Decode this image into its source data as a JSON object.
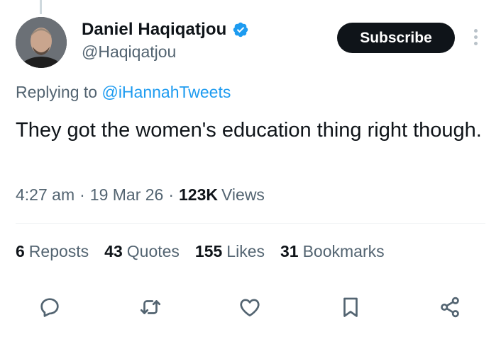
{
  "author": {
    "display_name": "Daniel Haqiqatjou",
    "handle": "@Haqiqatjou",
    "verified": true
  },
  "header": {
    "subscribe_label": "Subscribe"
  },
  "reply": {
    "prefix": "Replying to",
    "mention": "@iHannahTweets"
  },
  "tweet": {
    "text": "They got the women's education thing right though."
  },
  "meta": {
    "time": "4:27 am",
    "date": "19 Mar 26",
    "views_count": "123K",
    "views_label": "Views",
    "separator": "·"
  },
  "stats": [
    {
      "count": "6",
      "label": "Reposts"
    },
    {
      "count": "43",
      "label": "Quotes"
    },
    {
      "count": "155",
      "label": "Likes"
    },
    {
      "count": "31",
      "label": "Bookmarks"
    }
  ],
  "actions": [
    "reply-icon",
    "repost-icon",
    "like-icon",
    "bookmark-icon",
    "share-icon"
  ],
  "colors": {
    "accent": "#1d9bf0",
    "text": "#0f1419",
    "secondary": "#536471",
    "icon": "#536471"
  }
}
